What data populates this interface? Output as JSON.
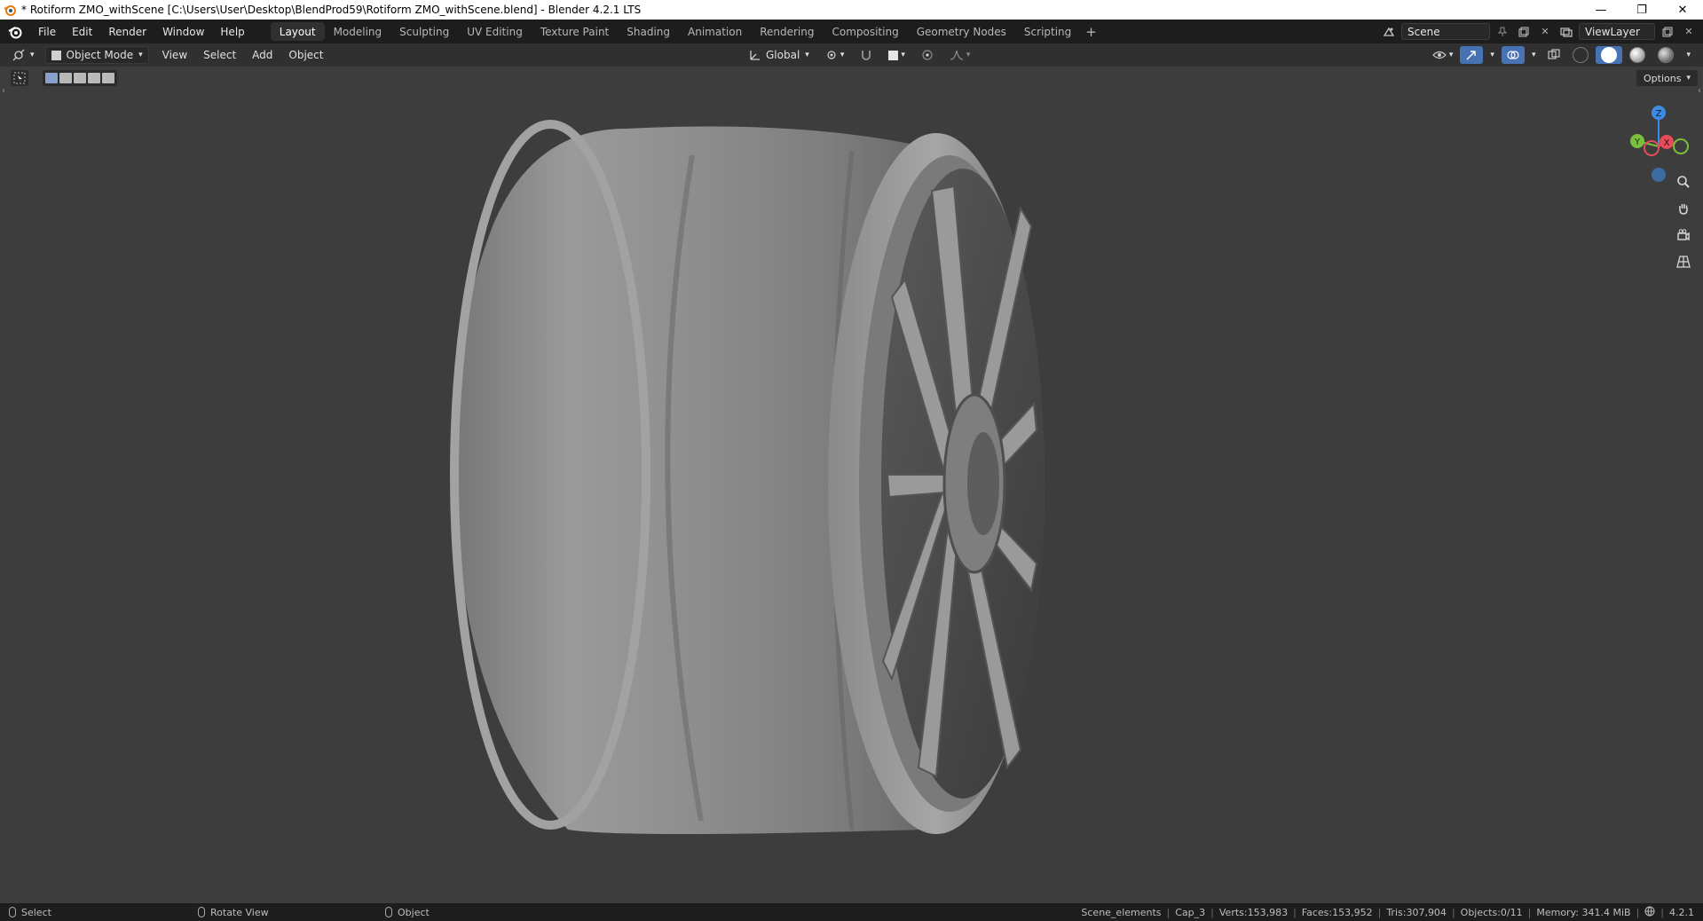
{
  "titlebar": {
    "title": "* Rotiform ZMO_withScene [C:\\Users\\User\\Desktop\\BlendProd59\\Rotiform ZMO_withScene.blend] - Blender 4.2.1 LTS",
    "minimize": "—",
    "maximize": "❐",
    "close": "✕"
  },
  "menubar": {
    "items": [
      "File",
      "Edit",
      "Render",
      "Window",
      "Help"
    ],
    "workspaces": [
      "Layout",
      "Modeling",
      "Sculpting",
      "UV Editing",
      "Texture Paint",
      "Shading",
      "Animation",
      "Rendering",
      "Compositing",
      "Geometry Nodes",
      "Scripting"
    ],
    "active_workspace": "Layout",
    "add_workspace": "+",
    "scene_label": "Scene",
    "viewlayer_label": "ViewLayer"
  },
  "viewport_header": {
    "mode": "Object Mode",
    "menus": [
      "View",
      "Select",
      "Add",
      "Object"
    ],
    "transform_orientation": "Global"
  },
  "viewport": {
    "options_label": "Options",
    "gizmo_axes": [
      "Z",
      "Y",
      "X"
    ],
    "colors": {
      "x_axis": "#e64c5a",
      "y_axis": "#7bbf3c",
      "z_axis": "#3c8ce6",
      "background": "#3d3d3d",
      "model": "#8a8a8a"
    }
  },
  "statusbar": {
    "hints": [
      {
        "icon": "mouse-left-icon",
        "label": "Select"
      },
      {
        "icon": "mouse-middle-icon",
        "label": "Rotate View"
      },
      {
        "icon": "mouse-right-icon",
        "label": "Object"
      }
    ],
    "stats": [
      "Scene_elements",
      "Cap_3",
      "Verts:153,983",
      "Faces:153,952",
      "Tris:307,904",
      "Objects:0/11",
      "Memory: 341.4 MiB"
    ],
    "version": "4.2.1"
  }
}
